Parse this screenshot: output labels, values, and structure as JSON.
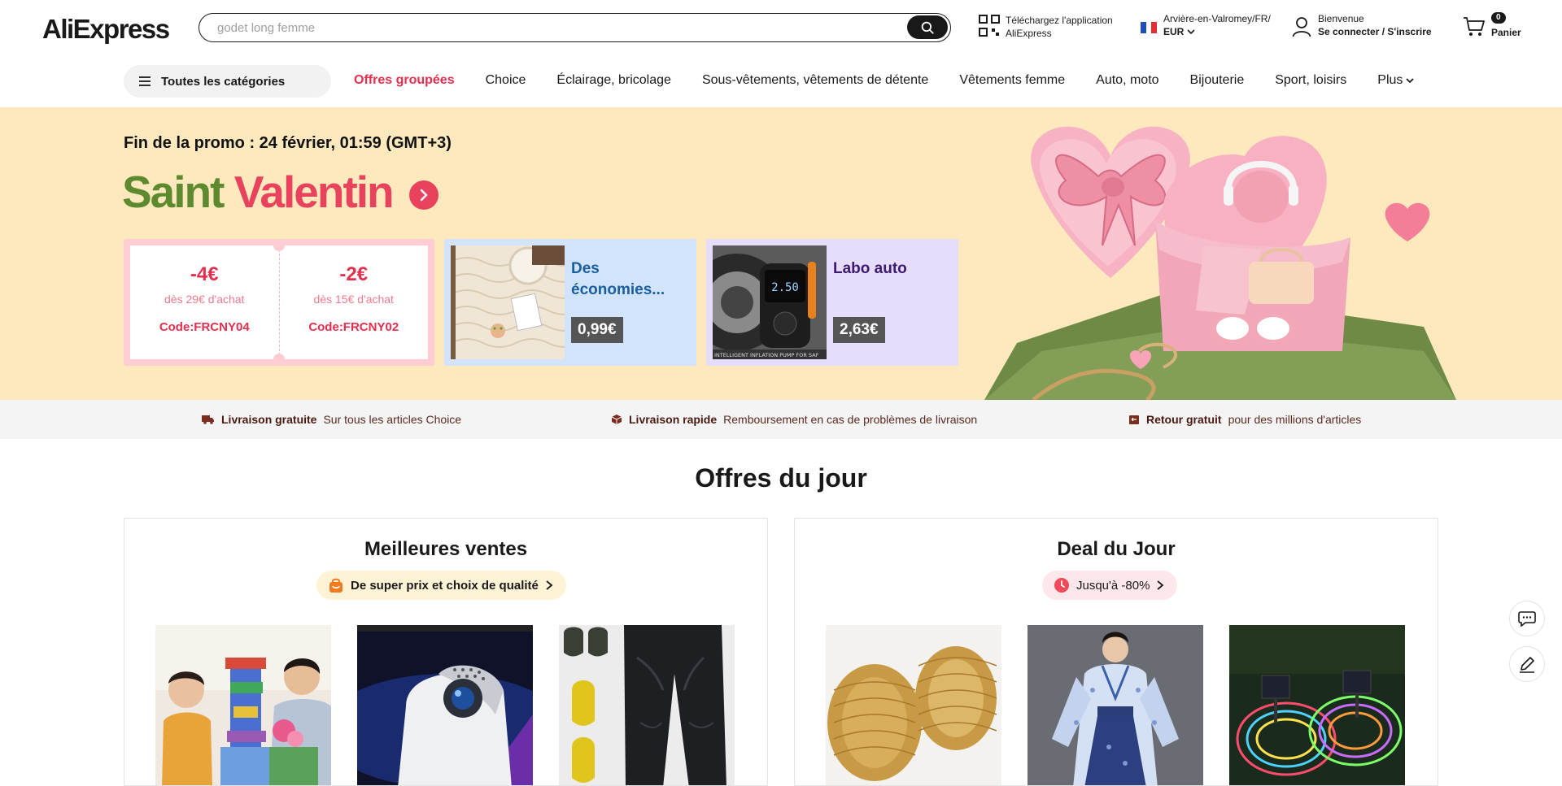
{
  "header": {
    "logo": "AliExpress",
    "search_placeholder": "godet long femme",
    "app_line1": "Téléchargez l'application",
    "app_line2": "AliExpress",
    "location": "Arvière-en-Valromey/FR/",
    "currency": "EUR",
    "welcome": "Bienvenue",
    "signin": "Se connecter / S'inscrire",
    "cart_count": "0",
    "cart_label": "Panier"
  },
  "nav": {
    "all_categories": "Toutes les catégories",
    "links": [
      "Offres groupées",
      "Choice",
      "Éclairage, bricolage",
      "Sous-vêtements, vêtements de détente",
      "Vêtements femme",
      "Auto, moto",
      "Bijouterie",
      "Sport, loisirs"
    ],
    "more": "Plus"
  },
  "banner": {
    "promo_end": "Fin de la promo : 24 février, 01:59 (GMT+3)",
    "title_word1": "Saint",
    "title_word2": "Valentin",
    "coupons": [
      {
        "amount": "-4€",
        "min": "dès 29€ d'achat",
        "code": "Code:FRCNY04"
      },
      {
        "amount": "-2€",
        "min": "dès 15€ d'achat",
        "code": "Code:FRCNY02"
      }
    ],
    "deals": [
      {
        "title": "Des économies...",
        "price": "0,99€"
      },
      {
        "title": "Labo auto",
        "price": "2,63€"
      }
    ],
    "pump_caption": "INTELLIGENT INFLATION PUMP FOR SAF",
    "pump_display": "2.50"
  },
  "benefits": [
    {
      "bold": "Livraison gratuite",
      "text": "Sur tous les articles Choice"
    },
    {
      "bold": "Livraison rapide",
      "text": "Remboursement en cas de problèmes de livraison"
    },
    {
      "bold": "Retour gratuit",
      "text": "pour des millions d'articles"
    }
  ],
  "offres": {
    "title": "Offres du jour",
    "best": {
      "title": "Meilleures ventes",
      "pill": "De super prix et choix de qualité"
    },
    "deal": {
      "title": "Deal du Jour",
      "pill": "Jusqu'à -80%"
    }
  },
  "colors": {
    "accent": "#e62e4d",
    "banner_bg": "#fde9bd",
    "title_green": "#5d8a2e",
    "title_pink": "#e8425c"
  }
}
